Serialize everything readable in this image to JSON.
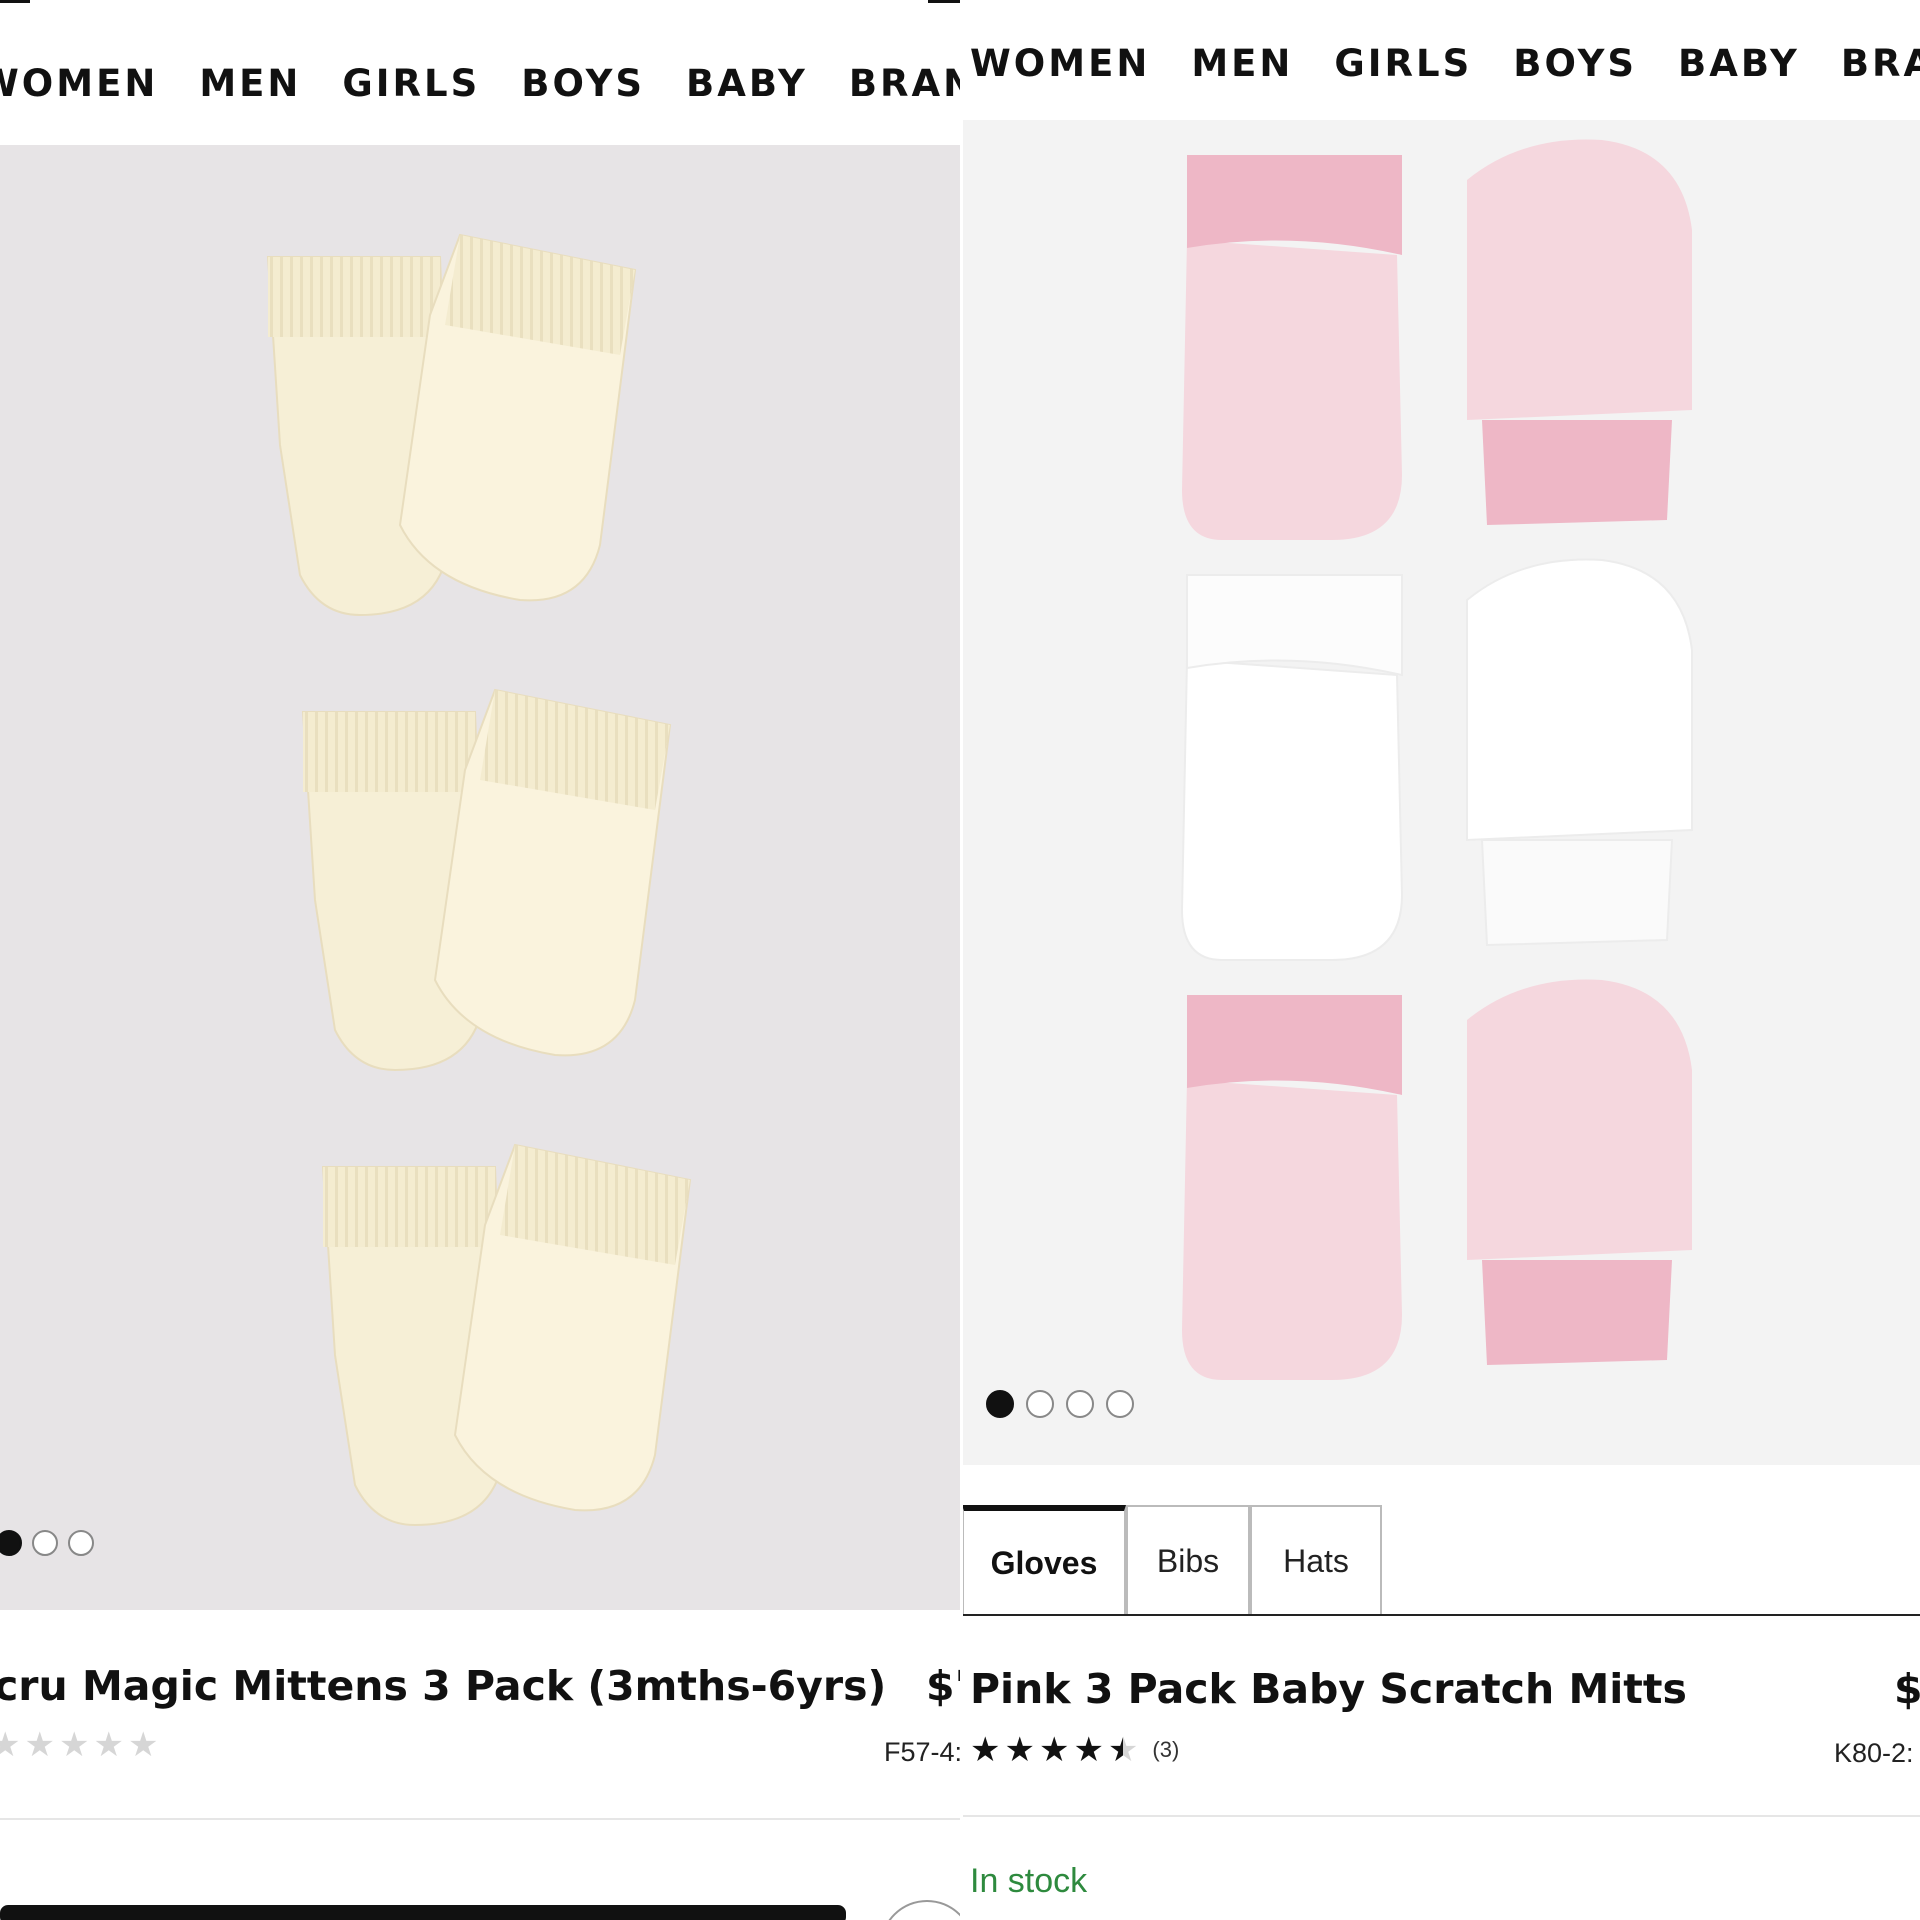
{
  "left": {
    "nav": [
      "WOMEN",
      "MEN",
      "GIRLS",
      "BOYS",
      "BABY",
      "BRANDS"
    ],
    "product": {
      "title": "cru Magic Mittens 3 Pack (3mths-6yrs)",
      "price": "$'",
      "code": "F57-4:",
      "rating": 0,
      "image": "Ecru knitted baby mittens, three pairs"
    },
    "carousel": {
      "count": 3,
      "active": 0
    }
  },
  "right": {
    "nav": [
      "WOMEN",
      "MEN",
      "GIRLS",
      "BOYS",
      "BABY",
      "BRANDS"
    ],
    "product": {
      "title": "Pink 3 Pack Baby Scratch Mitts",
      "price": "$",
      "code": "K80-2:",
      "rating": 4.5,
      "review_count": "(3)",
      "stock": "In stock",
      "image": "Pink and white baby scratch mitts, three pairs"
    },
    "carousel": {
      "count": 4,
      "active": 0
    },
    "tabs": [
      {
        "label": "Gloves",
        "active": true
      },
      {
        "label": "Bibs",
        "active": false
      },
      {
        "label": "Hats",
        "active": false
      }
    ]
  },
  "colors": {
    "ecru": "#f6efd6",
    "pink": "#f5d7de",
    "pink_cuff": "#eeb7c6",
    "white_mitt": "#ffffff",
    "stock_green": "#2e8a3e"
  }
}
